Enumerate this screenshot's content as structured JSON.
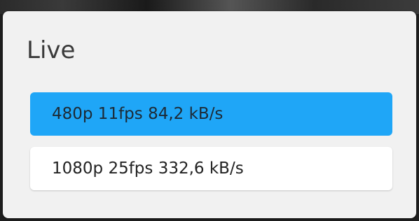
{
  "dialog": {
    "title": "Live",
    "options": [
      {
        "label": "480p 11fps 84,2 kB/s",
        "selected": true
      },
      {
        "label": "1080p 25fps 332,6 kB/s",
        "selected": false
      }
    ]
  },
  "colors": {
    "accent": "#1fa6f7",
    "dialog_background": "#f1f1f1",
    "option_background": "#ffffff"
  }
}
